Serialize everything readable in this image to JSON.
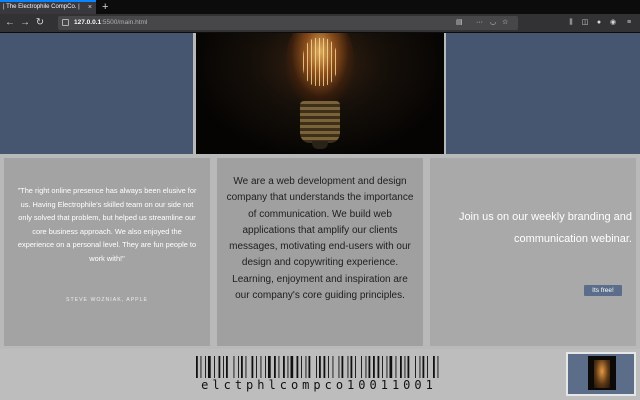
{
  "browser": {
    "tab_title": "| The Electrophile CompCo. |",
    "tab_close": "×",
    "new_tab": "+",
    "back": "←",
    "forward": "→",
    "reload": "↻",
    "url_host": "127.0.0.1",
    "url_path": ":5500/main.html",
    "more": "···",
    "bookmark": "☆"
  },
  "hero": {
    "left_color": "#475670",
    "right_color": "#475670"
  },
  "testimonial": {
    "quote": "\"The right online presence has always been elusive for us. Having Electrophile's skilled team on our side not only solved that problem, but helped us streamline our core business approach. We also enjoyed the experience on a personal level. They are fun people to work with!\"",
    "author": "STEVE WOZNIAK, APPLE"
  },
  "about": {
    "text": "We are a web development and design company that understands the importance of communication. We build web applications that amplify our clients messages, motivating end-users with our design and copywriting experience. Learning, enjoyment and inspiration are our company's core guiding principles."
  },
  "webinar": {
    "text": "Join us on our weekly branding and communication webinar.",
    "button_label": "Its free!",
    "button_color": "#5b6d8a"
  },
  "footer": {
    "barcode_text": "elctphlcompco10011001"
  }
}
